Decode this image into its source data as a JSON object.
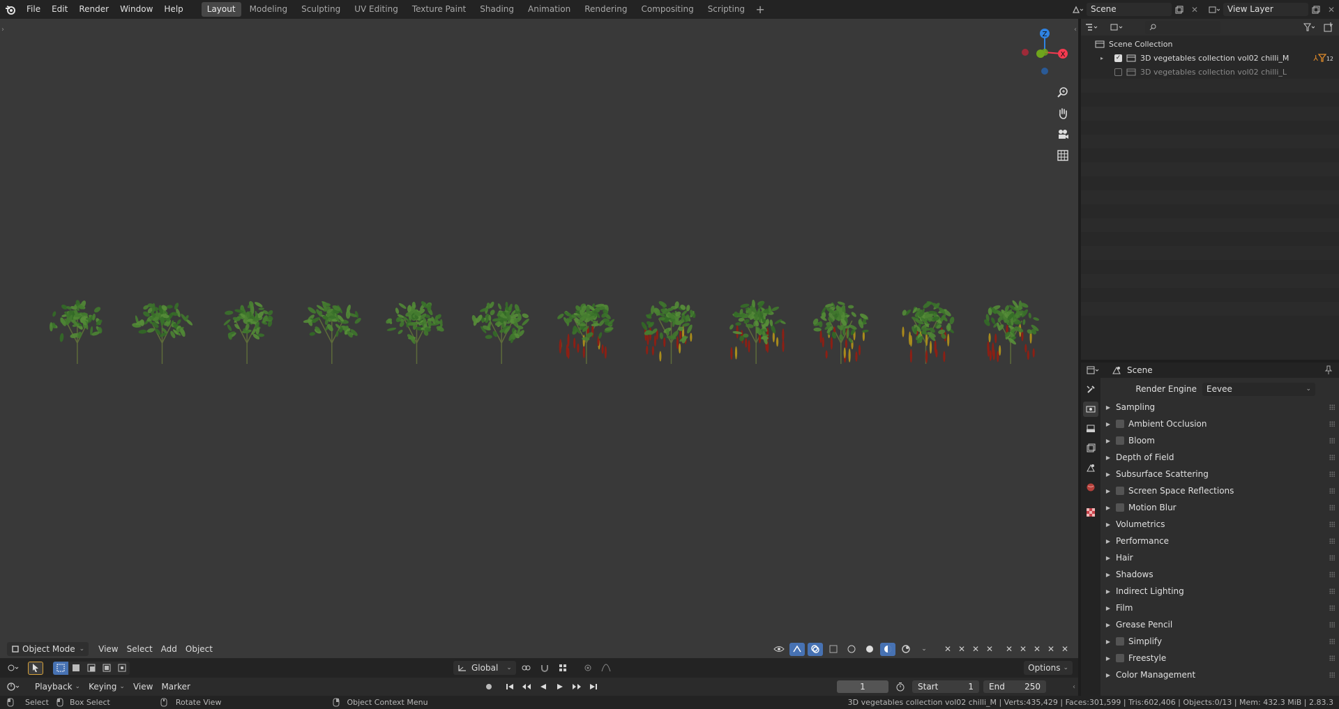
{
  "menubar": {
    "items": [
      "File",
      "Edit",
      "Render",
      "Window",
      "Help"
    ],
    "workspaces": [
      "Layout",
      "Modeling",
      "Sculpting",
      "UV Editing",
      "Texture Paint",
      "Shading",
      "Animation",
      "Rendering",
      "Compositing",
      "Scripting"
    ],
    "active_workspace": "Layout",
    "scene_name": "Scene",
    "view_layer_name": "View Layer"
  },
  "viewport": {
    "mode": "Object Mode",
    "menus": [
      "View",
      "Select",
      "Add",
      "Object"
    ],
    "gizmo_axes": [
      "Z",
      "Y",
      "X"
    ],
    "nav_icons": [
      "zoom-icon",
      "hand-pan-icon",
      "camera-icon",
      "grid-icon"
    ],
    "plant_count": 12,
    "plants_with_peppers": 6
  },
  "toolrow": {
    "orientation": "Global",
    "options_label": "Options"
  },
  "timeline": {
    "menus": [
      "Playback",
      "Keying",
      "View",
      "Marker"
    ],
    "current_frame": "1",
    "start_label": "Start",
    "start_value": "1",
    "end_label": "End",
    "end_value": "250"
  },
  "statusbar": {
    "select": "Select",
    "box_select": "Box Select",
    "rotate_view": "Rotate View",
    "context_menu": "Object Context Menu",
    "stats": "3D vegetables collection vol02 chilli_M | Verts:435,429 | Faces:301,599 | Tris:602,406 | Objects:0/13 | Mem: 432.3 MiB | 2.83.3"
  },
  "outliner": {
    "search_placeholder": "",
    "root": "Scene Collection",
    "collections": [
      {
        "name": "3D vegetables collection vol02 chilli_M",
        "checked": true
      },
      {
        "name": "3D vegetables collection vol02 chilli_L",
        "checked": false
      }
    ],
    "badge_count": "12"
  },
  "properties": {
    "context": "Scene",
    "render_engine_label": "Render Engine",
    "render_engine_value": "Eevee",
    "panels": [
      {
        "label": "Sampling",
        "checkbox": false
      },
      {
        "label": "Ambient Occlusion",
        "checkbox": true
      },
      {
        "label": "Bloom",
        "checkbox": true
      },
      {
        "label": "Depth of Field",
        "checkbox": false
      },
      {
        "label": "Subsurface Scattering",
        "checkbox": false
      },
      {
        "label": "Screen Space Reflections",
        "checkbox": true
      },
      {
        "label": "Motion Blur",
        "checkbox": true
      },
      {
        "label": "Volumetrics",
        "checkbox": false
      },
      {
        "label": "Performance",
        "checkbox": false
      },
      {
        "label": "Hair",
        "checkbox": false
      },
      {
        "label": "Shadows",
        "checkbox": false
      },
      {
        "label": "Indirect Lighting",
        "checkbox": false
      },
      {
        "label": "Film",
        "checkbox": false
      },
      {
        "label": "Grease Pencil",
        "checkbox": false
      },
      {
        "label": "Simplify",
        "checkbox": true
      },
      {
        "label": "Freestyle",
        "checkbox": true
      },
      {
        "label": "Color Management",
        "checkbox": false
      }
    ]
  },
  "colors": {
    "accent": "#4772b3",
    "axis_x": "#f53a50",
    "axis_y": "#6fa51c",
    "axis_z": "#2f83e3",
    "leaf": "#3e7a2a",
    "pepper": "#8c1f14"
  }
}
